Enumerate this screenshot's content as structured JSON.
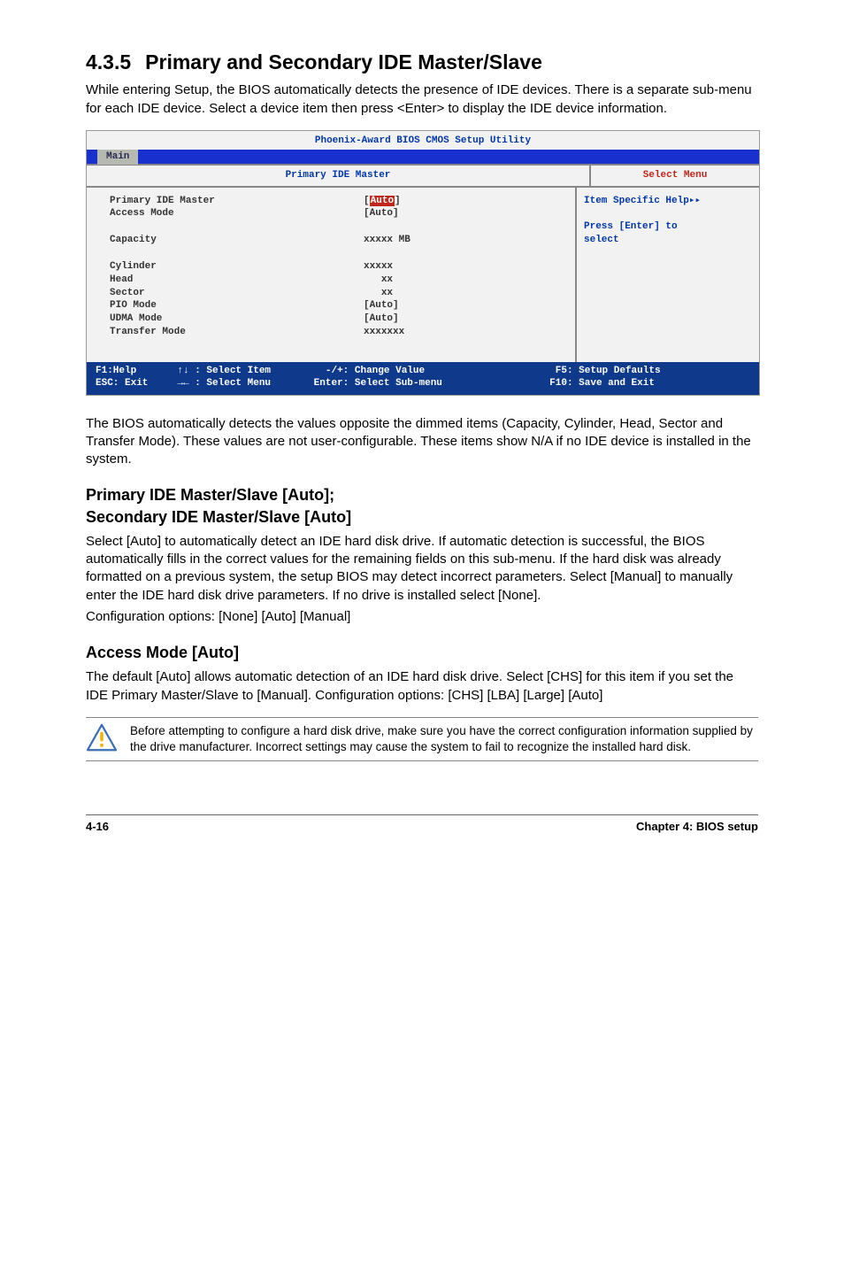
{
  "heading": {
    "number": "4.3.5",
    "title": "Primary and Secondary IDE Master/Slave"
  },
  "intro_para": "While entering Setup, the BIOS automatically detects the presence of IDE devices. There is a separate sub-menu for each IDE device. Select a device item then press <Enter> to display the IDE device information.",
  "bios": {
    "window_title": "Phoenix-Award BIOS CMOS Setup Utility",
    "tab": "Main",
    "panel_title": "Primary IDE Master",
    "side_title": "Select Menu",
    "items": {
      "l1": "Primary IDE Master",
      "l2": "Access Mode",
      "blank1": "",
      "l3": "Capacity",
      "blank2": "",
      "l4": "Cylinder",
      "l5": "Head",
      "l6": "Sector",
      "l7": "PIO Mode",
      "l8": "UDMA Mode",
      "l9": "Transfer Mode"
    },
    "values": {
      "v1_pre": "[",
      "v1_hl": "Auto",
      "v1_post": "]",
      "v2": "[Auto]",
      "blank1": "",
      "v3": "xxxxx MB",
      "blank2": "",
      "v4": "xxxxx",
      "v5": "   xx",
      "v6": "   xx",
      "v7": "[Auto]",
      "v8": "[Auto]",
      "v9": "xxxxxxx"
    },
    "help": {
      "line1": "Item Specific Help▸▸",
      "blank": "",
      "line2": "Press [Enter] to",
      "line3": "select"
    },
    "footer": {
      "c1": "F1:Help       ↑↓ : Select Item\nESC: Exit     →← : Select Menu",
      "c2": "  -/+: Change Value\nEnter: Select Sub-menu",
      "c3": "    F5: Setup Defaults\n   F10: Save and Exit"
    }
  },
  "after_bios_para": "The BIOS automatically detects the values opposite the dimmed items (Capacity, Cylinder,  Head, Sector and Transfer Mode). These values are not user-configurable. These items show N/A if no IDE device is installed in the system.",
  "sub1_line1": "Primary IDE Master/Slave [Auto];",
  "sub1_line2": "Secondary IDE Master/Slave [Auto]",
  "sub1_para": "Select [Auto] to automatically detect an IDE hard disk drive. If automatic detection is successful, the BIOS automatically fills in the correct values for the remaining fields on this sub-menu. If the hard disk was already formatted on a previous system, the setup BIOS may detect incorrect parameters. Select [Manual] to manually enter the IDE hard disk drive parameters. If no drive is installed select [None].",
  "sub1_cfg": "Configuration options: [None] [Auto] [Manual]",
  "sub2_title": "Access Mode [Auto]",
  "sub2_para": "The default [Auto] allows automatic detection of an IDE hard disk drive. Select [CHS] for this item if you set the IDE Primary Master/Slave to [Manual]. Configuration options: [CHS] [LBA] [Large] [Auto]",
  "note_text": "Before attempting to configure a hard disk drive, make sure you have the correct configuration information supplied by the drive manufacturer. Incorrect settings may cause the system to fail to recognize the installed hard disk.",
  "footer": {
    "left": "4-16",
    "right": "Chapter 4: BIOS setup"
  }
}
